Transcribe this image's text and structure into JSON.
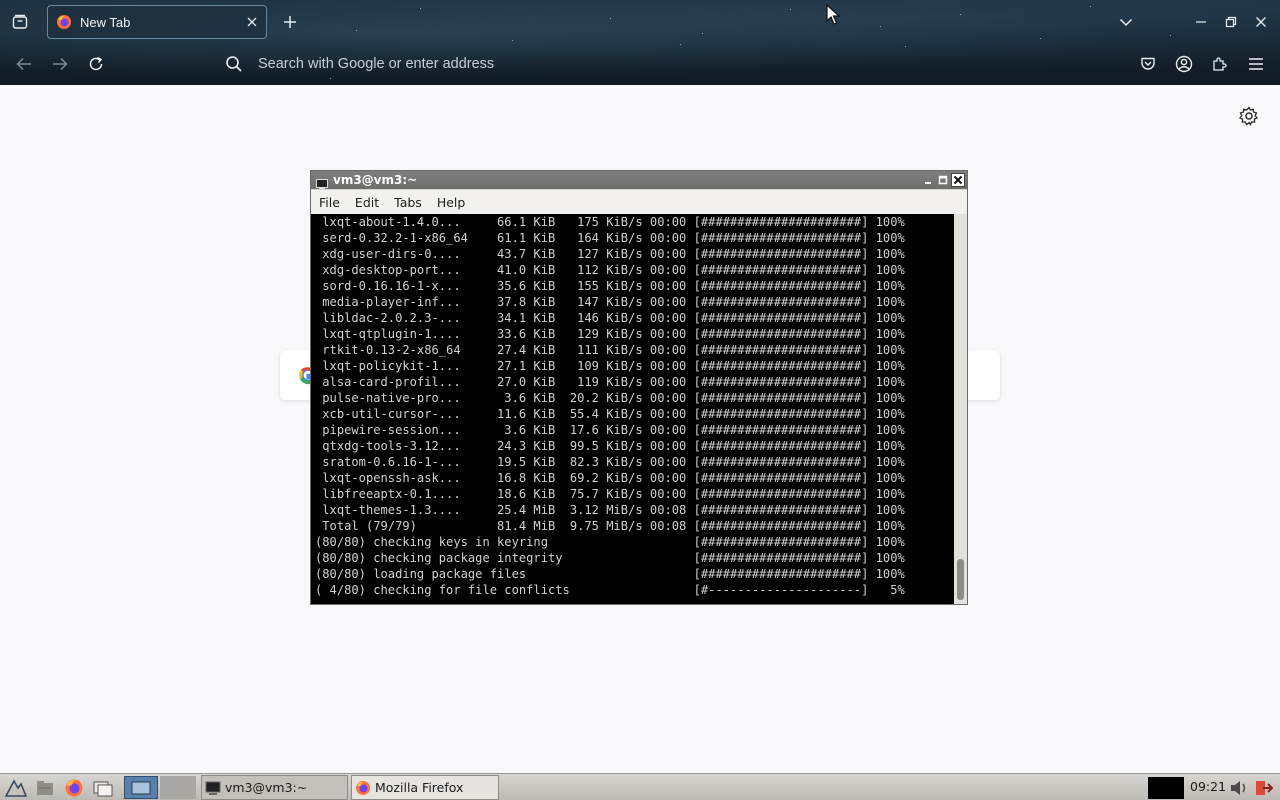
{
  "browser": {
    "tab": {
      "title": "New Tab"
    },
    "address_bar": {
      "placeholder": "Search with Google or enter address"
    }
  },
  "terminal": {
    "title": "vm3@vm3:~",
    "menu": [
      "File",
      "Edit",
      "Tabs",
      "Help"
    ],
    "lines": [
      " lxqt-about-1.4.0...     66.1 KiB   175 KiB/s 00:00 [######################] 100%",
      " serd-0.32.2-1-x86_64    61.1 KiB   164 KiB/s 00:00 [######################] 100%",
      " xdg-user-dirs-0....     43.7 KiB   127 KiB/s 00:00 [######################] 100%",
      " xdg-desktop-port...     41.0 KiB   112 KiB/s 00:00 [######################] 100%",
      " sord-0.16.16-1-x...     35.6 KiB   155 KiB/s 00:00 [######################] 100%",
      " media-player-inf...     37.8 KiB   147 KiB/s 00:00 [######################] 100%",
      " libldac-2.0.2.3-...     34.1 KiB   146 KiB/s 00:00 [######################] 100%",
      " lxqt-qtplugin-1....     33.6 KiB   129 KiB/s 00:00 [######################] 100%",
      " rtkit-0.13-2-x86_64     27.4 KiB   111 KiB/s 00:00 [######################] 100%",
      " lxqt-policykit-1...     27.1 KiB   109 KiB/s 00:00 [######################] 100%",
      " alsa-card-profil...     27.0 KiB   119 KiB/s 00:00 [######################] 100%",
      " pulse-native-pro...      3.6 KiB  20.2 KiB/s 00:00 [######################] 100%",
      " xcb-util-cursor-...     11.6 KiB  55.4 KiB/s 00:00 [######################] 100%",
      " pipewire-session...      3.6 KiB  17.6 KiB/s 00:00 [######################] 100%",
      " qtxdg-tools-3.12...     24.3 KiB  99.5 KiB/s 00:00 [######################] 100%",
      " sratom-0.6.16-1-...     19.5 KiB  82.3 KiB/s 00:00 [######################] 100%",
      " lxqt-openssh-ask...     16.8 KiB  69.2 KiB/s 00:00 [######################] 100%",
      " libfreeaptx-0.1....     18.6 KiB  75.7 KiB/s 00:00 [######################] 100%",
      " lxqt-themes-1.3....     25.4 MiB  3.12 MiB/s 00:08 [######################] 100%",
      " Total (79/79)           81.4 MiB  9.75 MiB/s 00:08 [######################] 100%",
      "(80/80) checking keys in keyring                    [######################] 100%",
      "(80/80) checking package integrity                  [######################] 100%",
      "(80/80) loading package files                       [######################] 100%",
      "( 4/80) checking for file conflicts                 [#---------------------]   5%"
    ]
  },
  "taskbar": {
    "tasks": [
      "vm3@vm3:~",
      "Mozilla Firefox"
    ],
    "clock": "09:21"
  }
}
